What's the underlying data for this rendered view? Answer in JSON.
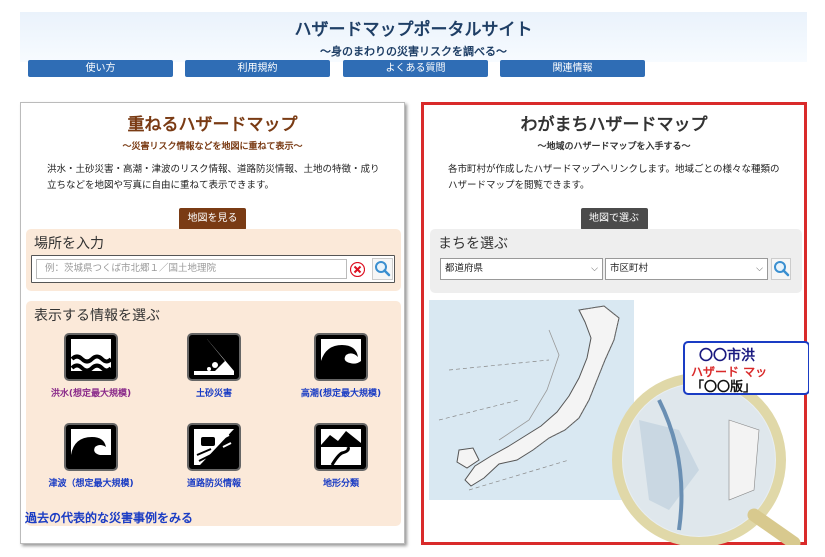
{
  "header": {
    "title": "ハザードマップポータルサイト",
    "subtitle": "〜身のまわりの災害リスクを調べる〜"
  },
  "nav": [
    {
      "label": "使い方"
    },
    {
      "label": "利用規約"
    },
    {
      "label": "よくある質問"
    },
    {
      "label": "関連情報"
    }
  ],
  "left": {
    "title": "重ねるハザードマップ",
    "subtitle": "〜災害リスク情報などを地図に重ねて表示〜",
    "description": "洪水・土砂災害・高潮・津波のリスク情報、道路防災情報、土地の特徴・成り立ちなどを地図や写真に自由に重ねて表示できます。",
    "map_button": "地図を見る",
    "location_label": "場所を入力",
    "search_placeholder": "例：茨城県つくば市北郷１／国土地理院",
    "info_label": "表示する情報を選ぶ",
    "hazards": [
      {
        "label": "洪水(想定最大規模)",
        "icon": "flood-icon"
      },
      {
        "label": "土砂災害",
        "icon": "landslide-icon"
      },
      {
        "label": "高潮(想定最大規模)",
        "icon": "storm-surge-icon"
      },
      {
        "label": "津波（想定最大規模)",
        "icon": "tsunami-icon"
      },
      {
        "label": "道路防災情報",
        "icon": "road-disaster-icon"
      },
      {
        "label": "地形分類",
        "icon": "terrain-icon"
      }
    ],
    "past_link": "過去の代表的な災害事例をみる"
  },
  "right": {
    "title": "わがまちハザードマップ",
    "subtitle": "〜地域のハザードマップを入手する〜",
    "description": "各市町村が作成したハザードマップへリンクします。地域ごとの様々な種類のハザードマップを閲覧できます。",
    "map_button": "地図で選ぶ",
    "town_label": "まちを選ぶ",
    "prefecture_select": "都道府県",
    "city_select": "市区町村",
    "map_sign": {
      "line1": "〇〇市洪",
      "line2": "ハザード マッ",
      "line3": "「〇〇版」"
    }
  },
  "colors": {
    "nav_blue": "#2f6db5",
    "left_accent": "#7a3b14",
    "right_border": "#d92a2a",
    "link_blue": "#1a3cc4",
    "purple_label": "#8a2a8a"
  }
}
